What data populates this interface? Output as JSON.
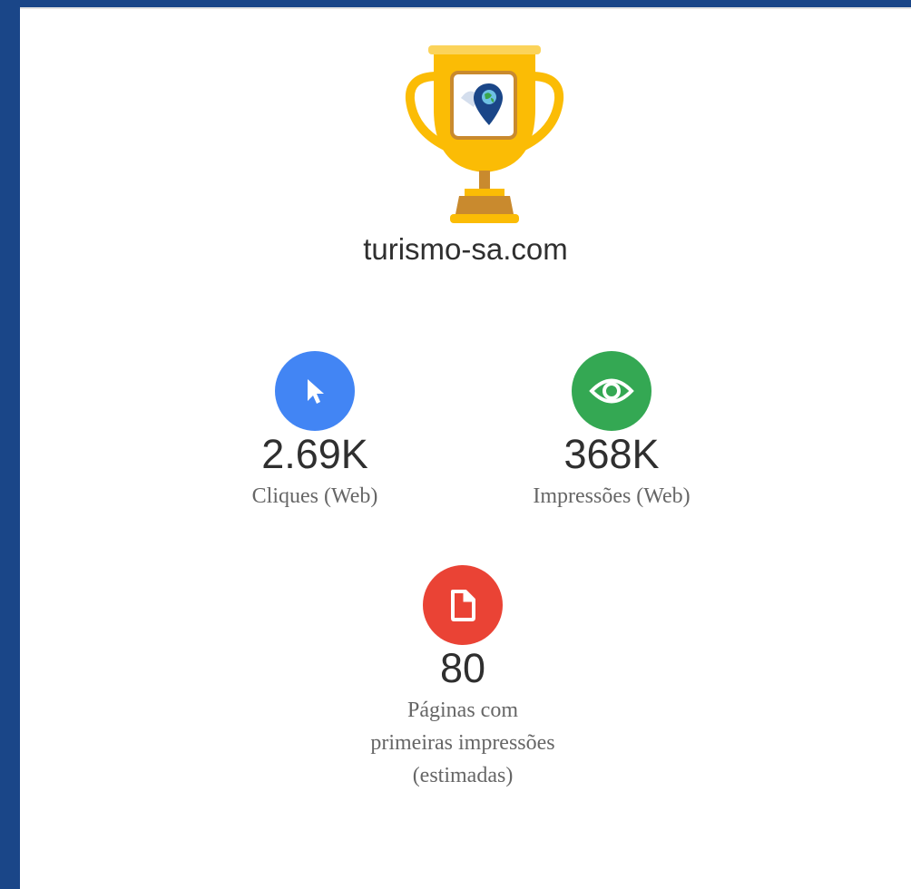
{
  "site": {
    "name": "turismo-sa.com"
  },
  "stats": [
    {
      "value": "2.69K",
      "label": "Cliques (Web)",
      "icon": "cursor-icon",
      "color": "#4285f4"
    },
    {
      "value": "368K",
      "label": "Impressões (Web)",
      "icon": "eye-icon",
      "color": "#34a853"
    },
    {
      "value": "80",
      "label_lines": [
        "Páginas com",
        "primeiras impressões",
        "(estimadas)"
      ],
      "icon": "page-icon",
      "color": "#ea4335"
    }
  ],
  "colors": {
    "frame": "#1a4688",
    "trophy_gold": "#fbbc05",
    "trophy_base": "#c98a2e"
  }
}
